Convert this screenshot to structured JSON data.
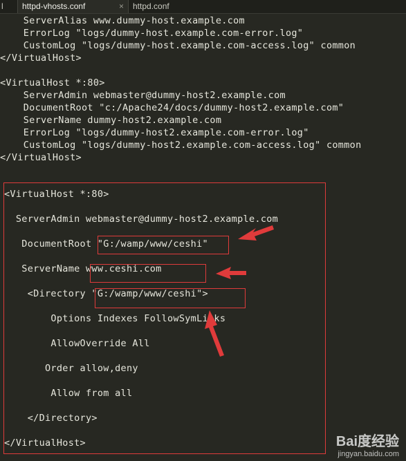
{
  "tabs": [
    {
      "label": "l",
      "active": false
    },
    {
      "label": "httpd-vhosts.conf",
      "active": true
    },
    {
      "label": "httpd.conf",
      "active": false
    }
  ],
  "tab_close_glyph": "×",
  "code_lines": [
    "    ServerAlias www.dummy-host.example.com",
    "    ErrorLog \"logs/dummy-host.example.com-error.log\"",
    "    CustomLog \"logs/dummy-host.example.com-access.log\" common",
    "</VirtualHost>",
    "",
    "<VirtualHost *:80>",
    "    ServerAdmin webmaster@dummy-host2.example.com",
    "    DocumentRoot \"c:/Apache24/docs/dummy-host2.example.com\"",
    "    ServerName dummy-host2.example.com",
    "    ErrorLog \"logs/dummy-host2.example.com-error.log\"",
    "    CustomLog \"logs/dummy-host2.example.com-access.log\" common",
    "</VirtualHost>"
  ],
  "highlighted_block": [
    "<VirtualHost *:80>",
    "  ServerAdmin webmaster@dummy-host2.example.com",
    "   DocumentRoot \"G:/wamp/www/ceshi\"",
    "   ServerName www.ceshi.com",
    "    <Directory \"G:/wamp/www/ceshi\">",
    "        Options Indexes FollowSymLinks",
    "        AllowOverride All",
    "       Order allow,deny",
    "        Allow from all",
    "    </Directory>",
    "</VirtualHost>"
  ],
  "watermark": {
    "brand": "Bai度经验",
    "url": "jingyan.baidu.com"
  },
  "colors": {
    "background": "#272822",
    "text": "#e6e6dc",
    "annotation_red": "#e03b3b"
  }
}
